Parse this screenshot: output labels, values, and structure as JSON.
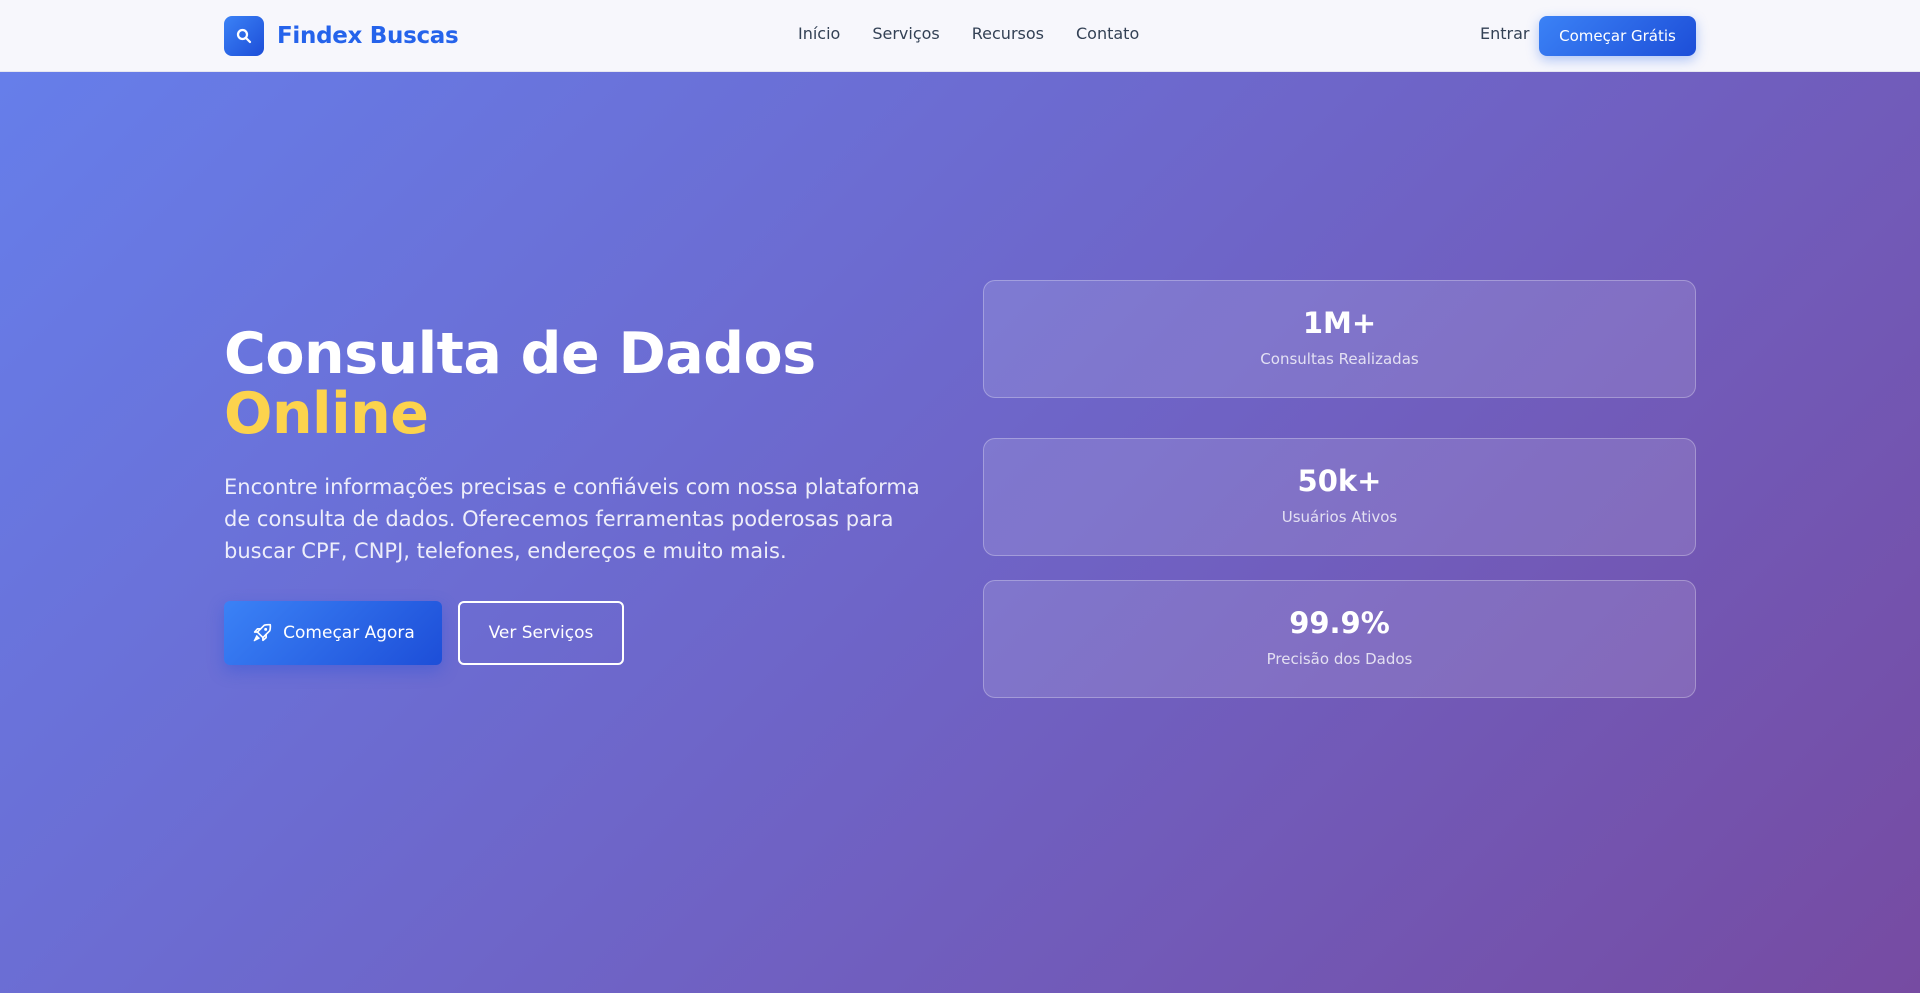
{
  "header": {
    "brand": "Findex Buscas",
    "nav": [
      "Início",
      "Serviços",
      "Recursos",
      "Contato"
    ],
    "login_label": "Entrar",
    "cta_label": "Começar Grátis"
  },
  "hero": {
    "title_line1": "Consulta de Dados",
    "title_line2": "Online",
    "description": "Encontre informações precisas e confiáveis com nossa plataforma de consulta de dados. Oferecemos ferramentas poderosas para buscar CPF, CNPJ, telefones, endereços e muito mais.",
    "primary_button": "Começar Agora",
    "secondary_button": "Ver Serviços",
    "stats": [
      {
        "value": "1M+",
        "label": "Consultas Realizadas"
      },
      {
        "value": "50k+",
        "label": "Usuários Ativos"
      },
      {
        "value": "99.9%",
        "label": "Precisão dos Dados"
      }
    ]
  },
  "icons": {
    "logo": "search-icon",
    "primary_button": "rocket-icon"
  },
  "colors": {
    "brand_blue": "#2563eb",
    "hero_gradient_start": "#667eea",
    "hero_gradient_end": "#764ba2",
    "accent_yellow": "#fcd34d"
  }
}
